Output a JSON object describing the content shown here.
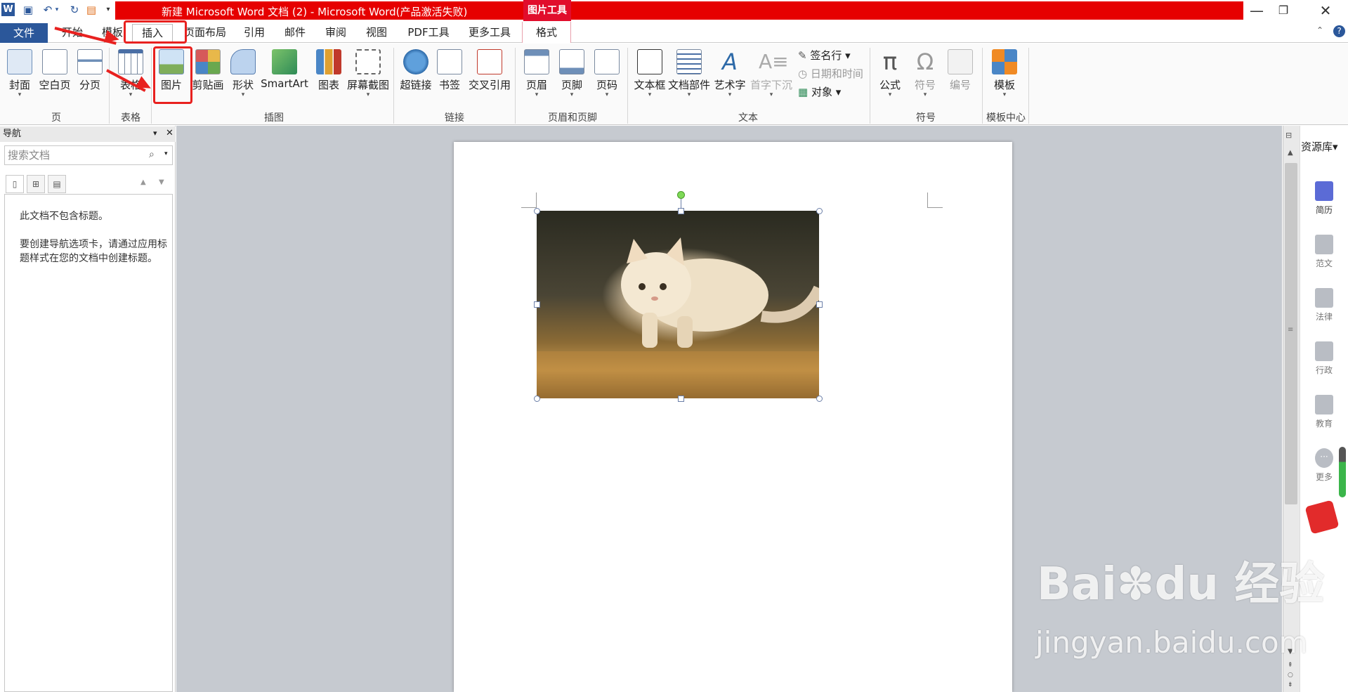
{
  "window": {
    "title": "新建 Microsoft Word 文档 (2) - Microsoft Word(产品激活失败)",
    "context_tool": "图片工具",
    "colors": {
      "title_red": "#e60000",
      "file_blue": "#2b579a",
      "callout_red": "#e8211f"
    }
  },
  "tabs": {
    "file": "文件",
    "home": "开始",
    "template": "模板",
    "insert": "插入",
    "layout": "页面布局",
    "references": "引用",
    "mailings": "邮件",
    "review": "审阅",
    "view": "视图",
    "pdf": "PDF工具",
    "more": "更多工具",
    "format": "格式"
  },
  "ribbon": {
    "groups": {
      "pages": "页",
      "tables": "表格",
      "illustrations": "插图",
      "links": "链接",
      "header_footer": "页眉和页脚",
      "text": "文本",
      "symbols": "符号",
      "template_center": "模板中心"
    },
    "buttons": {
      "cover": "封面",
      "blank_page": "空白页",
      "page_break": "分页",
      "table": "表格",
      "picture": "图片",
      "clipart": "剪贴画",
      "shapes": "形状",
      "smartart": "SmartArt",
      "chart": "图表",
      "screenshot": "屏幕截图",
      "hyperlink": "超链接",
      "bookmark": "书签",
      "cross_ref": "交叉引用",
      "header": "页眉",
      "footer": "页脚",
      "page_number": "页码",
      "textbox": "文本框",
      "quick_parts": "文档部件",
      "wordart": "艺术字",
      "dropcap": "首字下沉",
      "signature": "签名行",
      "datetime": "日期和时间",
      "object": "对象",
      "equation": "公式",
      "symbol": "符号",
      "numbering": "编号",
      "templates": "模板"
    }
  },
  "nav": {
    "title": "导航",
    "search_placeholder": "搜索文档",
    "msg1": "此文档不包含标题。",
    "msg2": "要创建导航选项卡，请通过应用标题样式在您的文档中创建标题。"
  },
  "resources": {
    "title": "资源库",
    "items": [
      "简历",
      "范文",
      "法律",
      "行政",
      "教育",
      "更多"
    ]
  },
  "watermark": {
    "logo": "Bai du 经验",
    "url": "jingyan.baidu.com"
  }
}
